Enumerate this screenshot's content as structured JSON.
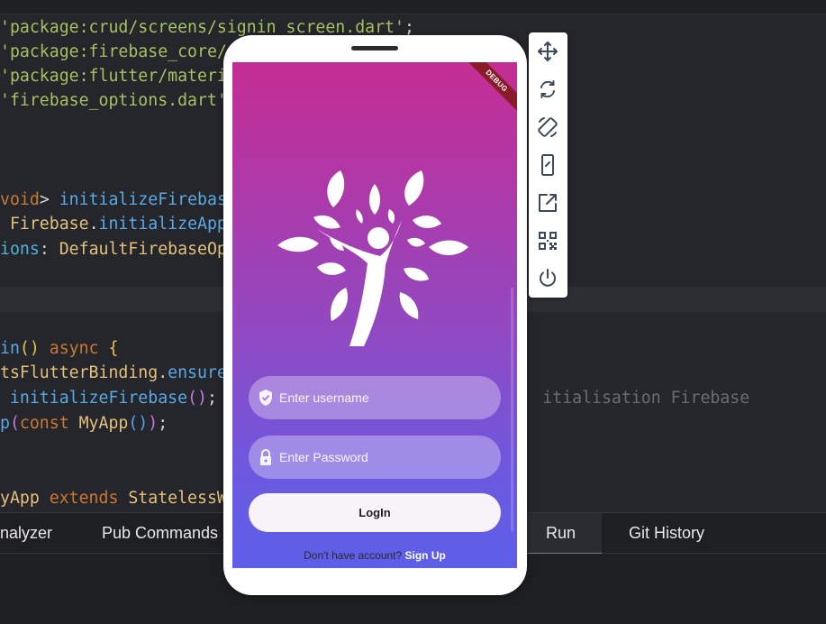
{
  "editor": {
    "lines": [
      [
        {
          "t": "'package:crud/screens/signin_screen.dart'",
          "c": "str"
        },
        {
          "t": ";",
          "c": "plain"
        }
      ],
      [
        {
          "t": "'package:firebase_core/",
          "c": "str"
        }
      ],
      [
        {
          "t": "'package:flutter/materi",
          "c": "str"
        }
      ],
      [
        {
          "t": "'firebase_options.dart'",
          "c": "str"
        }
      ],
      [],
      [],
      [
        {
          "t": "void",
          "c": "kw"
        },
        {
          "t": "> ",
          "c": "plain"
        },
        {
          "t": "initializeFirebas",
          "c": "fn"
        }
      ],
      [
        {
          "t": " Firebase",
          "c": "cls"
        },
        {
          "t": ".",
          "c": "plain"
        },
        {
          "t": "initializeApp",
          "c": "fn"
        }
      ],
      [
        {
          "t": "ions",
          "c": "prop"
        },
        {
          "t": ": ",
          "c": "plain"
        },
        {
          "t": "DefaultFirebaseOp",
          "c": "cls"
        }
      ],
      [],
      [],
      [
        {
          "t": "in",
          "c": "fn"
        },
        {
          "t": "() ",
          "c": "paren-y"
        },
        {
          "t": "async",
          "c": "kw"
        },
        {
          "t": " {",
          "c": "paren-y"
        }
      ],
      [
        {
          "t": "tsFlutterBinding",
          "c": "cls"
        },
        {
          "t": ".",
          "c": "plain"
        },
        {
          "t": "ensure",
          "c": "fn"
        }
      ],
      [
        {
          "t": " ",
          "c": "plain"
        },
        {
          "t": "initializeFirebase",
          "c": "fn"
        },
        {
          "t": "()",
          "c": "paren-p"
        },
        {
          "t": ";",
          "c": "plain"
        },
        {
          "t": "                                 itialisation Firebase",
          "c": "cmt"
        }
      ],
      [
        {
          "t": "p",
          "c": "fn"
        },
        {
          "t": "(",
          "c": "paren-p"
        },
        {
          "t": "const ",
          "c": "kw"
        },
        {
          "t": "MyApp",
          "c": "cls"
        },
        {
          "t": "()",
          "c": "paren-b"
        },
        {
          "t": ")",
          "c": "paren-p"
        },
        {
          "t": ";",
          "c": "plain"
        }
      ],
      [],
      [],
      [
        {
          "t": "yApp ",
          "c": "cls"
        },
        {
          "t": "extends ",
          "c": "kw"
        },
        {
          "t": "StatelessW",
          "c": "cls"
        }
      ]
    ]
  },
  "panel": {
    "tabs": [
      {
        "label": "nalyzer",
        "name": "tab-analyzer",
        "active": false
      },
      {
        "label": "Pub Commands",
        "name": "tab-pub-commands",
        "active": false
      },
      {
        "label": "Run",
        "name": "tab-run",
        "active": true
      },
      {
        "label": "Git History",
        "name": "tab-git-history",
        "active": false
      }
    ]
  },
  "app": {
    "debug_banner": "DEBUG",
    "username_placeholder": "Enter username",
    "password_placeholder": "Enter Password",
    "login_label": "LogIn",
    "signup_question": "Don't have account?",
    "signup_link": "Sign Up",
    "colors": {
      "gradient_top": "#c42d93",
      "gradient_bottom": "#5d5fe9"
    }
  },
  "device_toolbar": {
    "buttons": [
      {
        "icon": "move-icon"
      },
      {
        "icon": "rotate-icon"
      },
      {
        "icon": "screen-rotation-icon"
      },
      {
        "icon": "device-icon"
      },
      {
        "icon": "open-external-icon"
      },
      {
        "icon": "qr-code-icon"
      },
      {
        "icon": "power-icon"
      }
    ]
  }
}
